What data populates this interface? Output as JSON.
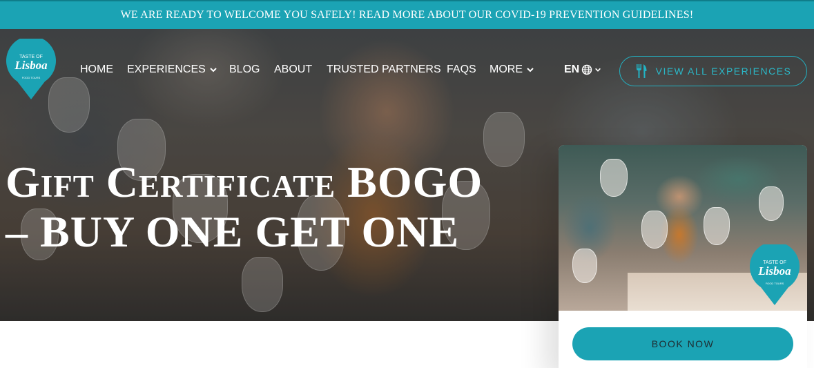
{
  "announcement": {
    "text": "WE ARE READY TO WELCOME YOU SAFELY! READ MORE ABOUT OUR COVID-19 PREVENTION GUIDELINES!"
  },
  "brand": {
    "logo_top": "TASTE OF",
    "logo_main": "Lisboa",
    "logo_sub": "FOOD TOURS"
  },
  "nav": {
    "items": [
      {
        "label": "HOME"
      },
      {
        "label": "EXPERIENCES"
      },
      {
        "label": "BLOG"
      },
      {
        "label": "ABOUT"
      },
      {
        "label": "TRUSTED PARTNERS"
      },
      {
        "label": "FAQS"
      },
      {
        "label": "MORE"
      }
    ],
    "language": "EN",
    "cta_label": "VIEW ALL EXPERIENCES"
  },
  "hero": {
    "title_line1": "Gift Certificate BOGO",
    "title_line2": "– BUY ONE GET ONE"
  },
  "card": {
    "book_label": "BOOK NOW"
  },
  "colors": {
    "accent": "#1ba3b4",
    "accent_light": "#2bb7c7"
  },
  "icons": [
    "globe-icon",
    "chevron-down-icon",
    "fork-knife-icon",
    "logo-pin-icon"
  ]
}
